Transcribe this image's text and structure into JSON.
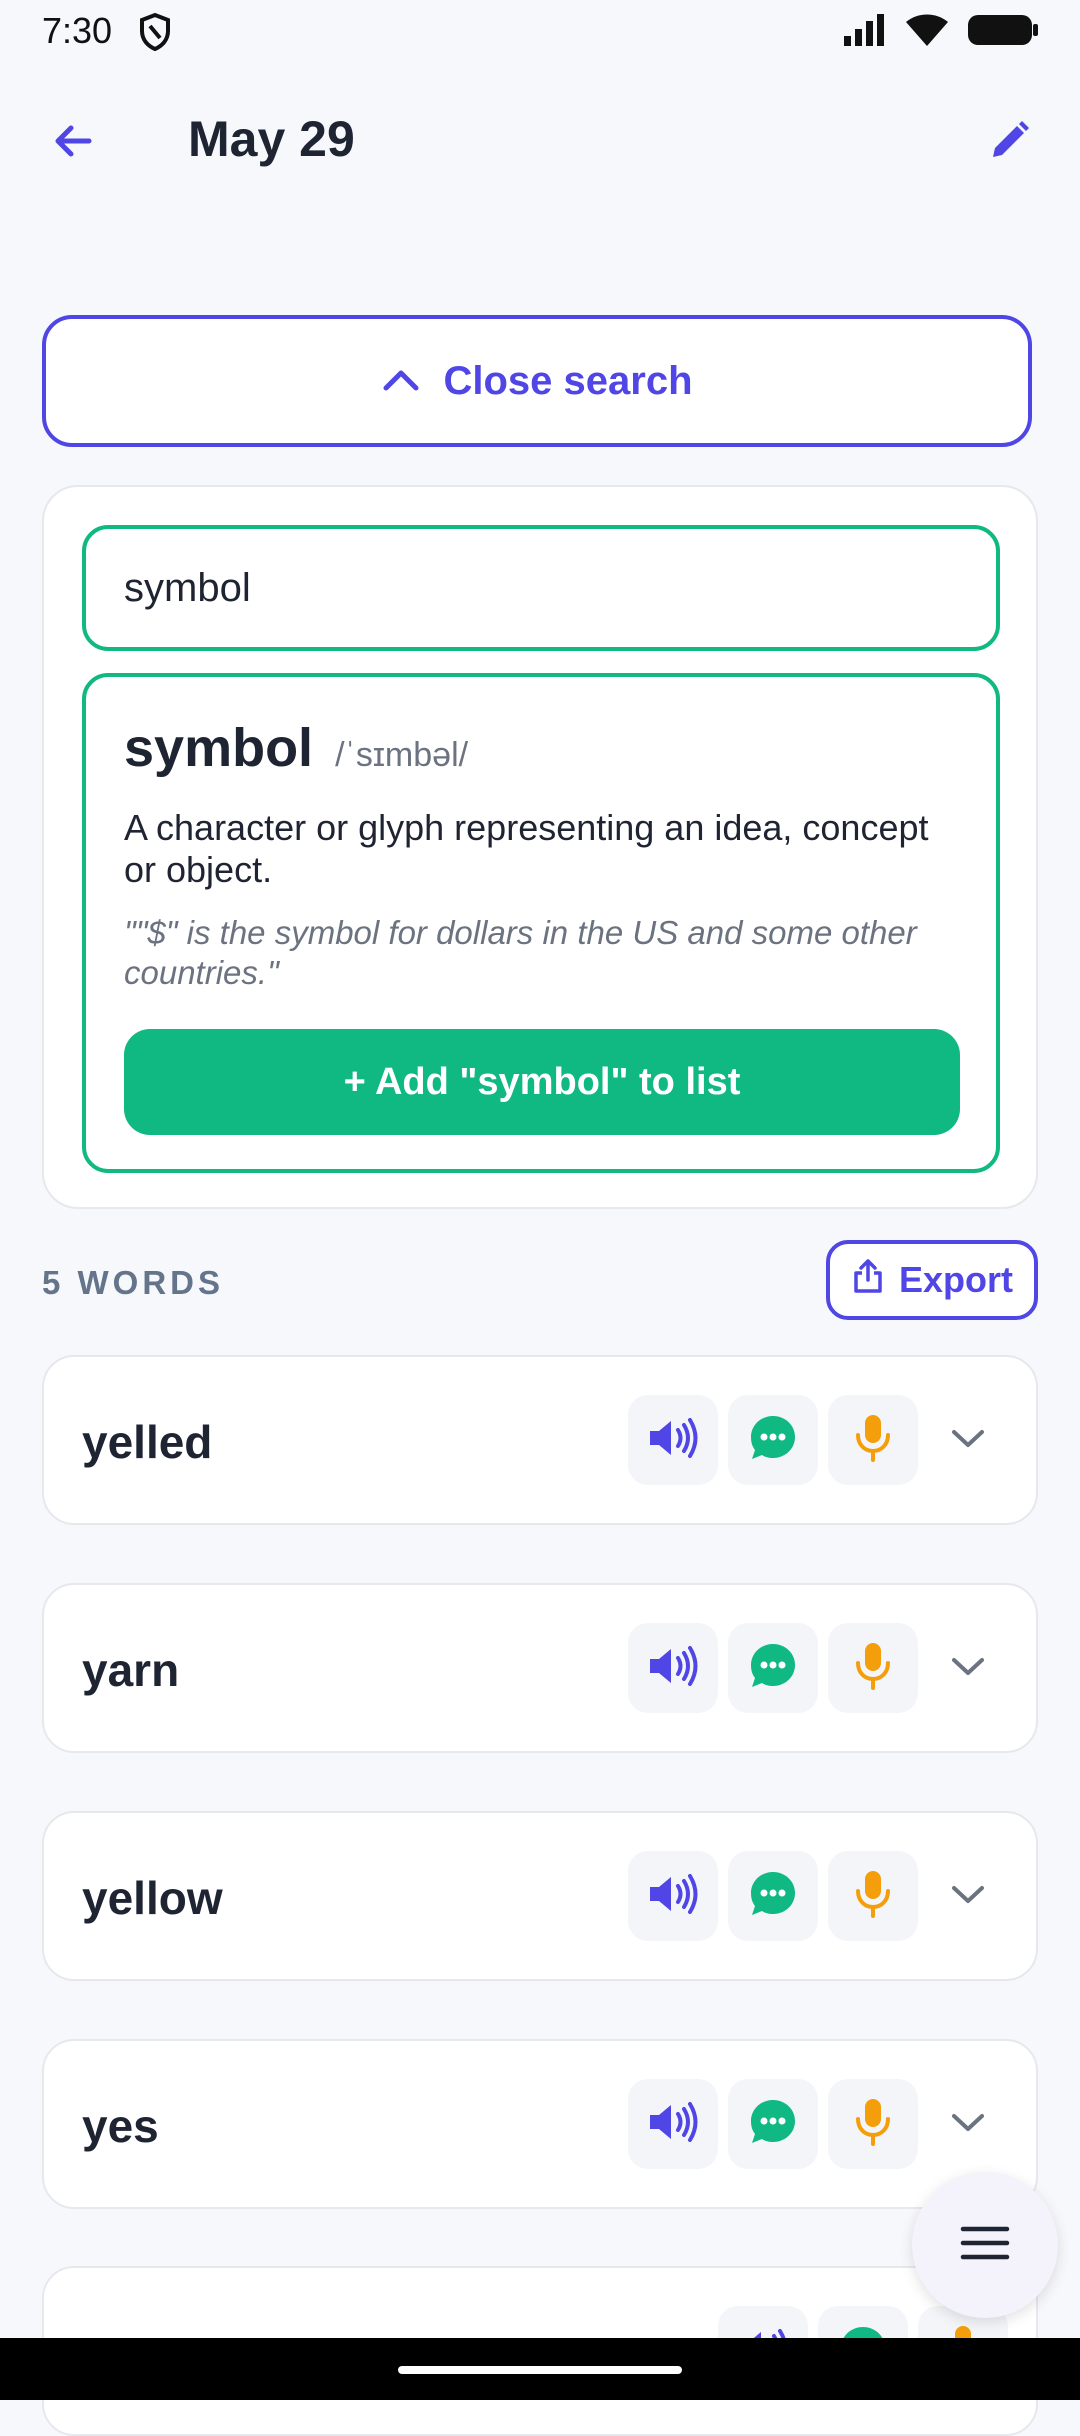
{
  "status": {
    "time": "7:30"
  },
  "header": {
    "title": "May 29"
  },
  "search": {
    "close_label": "Close search",
    "query": "symbol"
  },
  "result": {
    "word": "symbol",
    "ipa": "/ˈsɪmbəl/",
    "definition": "A character or glyph representing an idea, concept or object.",
    "example": "\"\"$\" is the symbol for dollars in the US and some other countries.\"",
    "add_label": "+ Add \"symbol\" to list"
  },
  "list": {
    "count_label": "5 WORDS",
    "export_label": "Export",
    "words": [
      {
        "label": "yelled"
      },
      {
        "label": "yarn"
      },
      {
        "label": "yellow"
      },
      {
        "label": "yes"
      },
      {
        "label": ""
      }
    ]
  },
  "colors": {
    "accent": "#4f46e5",
    "green": "#10b981",
    "mic": "#f59e0b",
    "muted": "#64748b"
  },
  "icons": [
    "back-arrow-icon",
    "edit-pencil-icon",
    "chevron-up-icon",
    "share-icon",
    "speaker-icon",
    "chat-bubble-icon",
    "microphone-icon",
    "chevron-down-icon",
    "menu-icon"
  ]
}
